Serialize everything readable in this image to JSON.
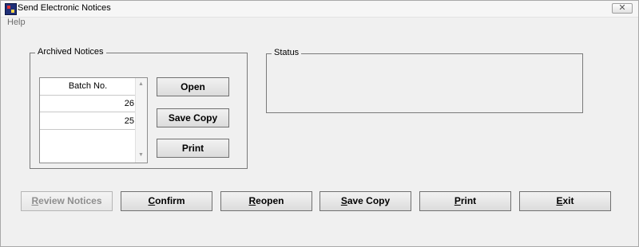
{
  "window": {
    "title": "Send Electronic Notices",
    "close_glyph": "✕"
  },
  "menu": {
    "help": "Help"
  },
  "archived": {
    "legend": "Archived Notices",
    "list_header": "Batch No.",
    "rows": [
      "26",
      "25"
    ],
    "buttons": {
      "open": "Open",
      "save_copy": "Save Copy",
      "print": "Print"
    }
  },
  "status": {
    "legend": "Status"
  },
  "bottom_buttons": {
    "review": {
      "mnemonic": "R",
      "rest": "eview Notices"
    },
    "confirm": {
      "mnemonic": "C",
      "rest": "onfirm"
    },
    "reopen": {
      "mnemonic": "R",
      "rest": "eopen"
    },
    "save_copy": {
      "mnemonic": "S",
      "rest": "ave Copy"
    },
    "print": {
      "mnemonic": "P",
      "rest": "rint"
    },
    "exit": {
      "mnemonic": "E",
      "rest": "xit"
    }
  },
  "icons": {
    "app": "app-icon",
    "close": "close-icon",
    "scroll_up": "scroll-up-icon",
    "scroll_down": "scroll-down-icon"
  }
}
